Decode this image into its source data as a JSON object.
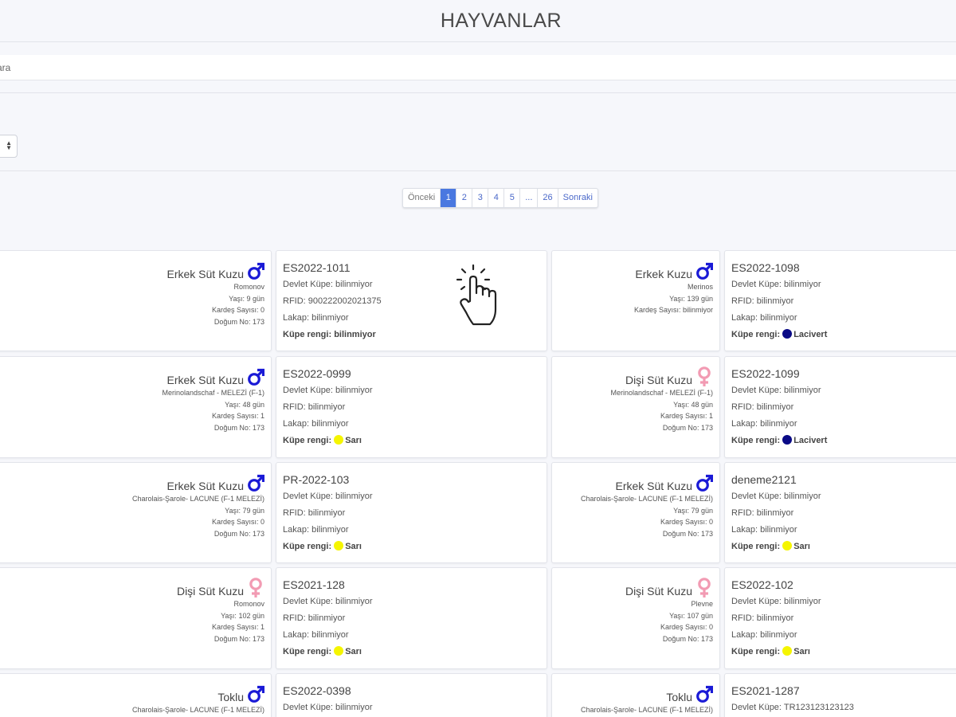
{
  "header": {
    "title": "HAYVANLAR"
  },
  "search": {
    "placeholder": "ara",
    "visible_prefix": "o ara"
  },
  "pagination": {
    "previous": "Önceki",
    "pages": [
      "1",
      "2",
      "3",
      "4",
      "5",
      "...",
      "26"
    ],
    "active": "1",
    "next": "Sonraki"
  },
  "colors": {
    "male": "#1a1ad6",
    "female": "#f29bb3",
    "active_page": "#4a78e0",
    "sari": "#f5f500",
    "lacivert": "#0a0a86"
  },
  "labels": {
    "devlet": "Devlet Küpe:",
    "rfid": "RFID:",
    "lakap": "Lakap:",
    "kupe_rengi": "Küpe rengi:",
    "yas": "Yaşı:",
    "kardes": "Kardeş Sayısı:",
    "dogum": "Doğum No:"
  },
  "cards": [
    {
      "type": "Erkek Süt Kuzu",
      "gender": "male",
      "breed": "Romonov",
      "age": "9 gün",
      "siblings": "0",
      "birth_no": "173",
      "tag": "ES2022-1011",
      "devlet": "bilinmiyor",
      "rfid": "900222002021375",
      "lakap": "bilinmiyor",
      "color": "bilinmiyor",
      "color_hex": ""
    },
    {
      "type": "Erkek Kuzu",
      "gender": "male",
      "breed": "Merinos",
      "age": "139 gün",
      "siblings": "bilinmiyor",
      "birth_no": "",
      "tag": "ES2022-1098",
      "devlet": "bilinmiyor",
      "rfid": "bilinmiyor",
      "lakap": "bilinmiyor",
      "color": "Lacivert",
      "color_hex": "#0a0a86"
    },
    {
      "type": "Erkek Süt Kuzu",
      "gender": "male",
      "breed": "Merinolandschaf - MELEZİ (F-1)",
      "age": "48 gün",
      "siblings": "1",
      "birth_no": "173",
      "tag": "ES2022-0999",
      "devlet": "bilinmiyor",
      "rfid": "bilinmiyor",
      "lakap": "bilinmiyor",
      "color": "Sarı",
      "color_hex": "#f5f500"
    },
    {
      "type": "Dişi Süt Kuzu",
      "gender": "female",
      "breed": "Merinolandschaf - MELEZİ (F-1)",
      "age": "48 gün",
      "siblings": "1",
      "birth_no": "173",
      "tag": "ES2022-1099",
      "devlet": "bilinmiyor",
      "rfid": "bilinmiyor",
      "lakap": "bilinmiyor",
      "color": "Lacivert",
      "color_hex": "#0a0a86"
    },
    {
      "type": "Erkek Süt Kuzu",
      "gender": "male",
      "breed": "Charolais-Şarole- LACUNE (F-1 MELEZİ)",
      "age": "79 gün",
      "siblings": "0",
      "birth_no": "173",
      "tag": "PR-2022-103",
      "devlet": "bilinmiyor",
      "rfid": "bilinmiyor",
      "lakap": "bilinmiyor",
      "color": "Sarı",
      "color_hex": "#f5f500"
    },
    {
      "type": "Erkek Süt Kuzu",
      "gender": "male",
      "breed": "Charolais-Şarole- LACUNE (F-1 MELEZİ)",
      "age": "79 gün",
      "siblings": "0",
      "birth_no": "173",
      "tag": "deneme2121",
      "devlet": "bilinmiyor",
      "rfid": "bilinmiyor",
      "lakap": "bilinmiyor",
      "color": "Sarı",
      "color_hex": "#f5f500"
    },
    {
      "type": "Dişi Süt Kuzu",
      "gender": "female",
      "breed": "Romonov",
      "age": "102 gün",
      "siblings": "1",
      "birth_no": "173",
      "tag": "ES2021-128",
      "devlet": "bilinmiyor",
      "rfid": "bilinmiyor",
      "lakap": "bilinmiyor",
      "color": "Sarı",
      "color_hex": "#f5f500"
    },
    {
      "type": "Dişi Süt Kuzu",
      "gender": "female",
      "breed": "Plevne",
      "age": "107 gün",
      "siblings": "0",
      "birth_no": "173",
      "tag": "ES2022-102",
      "devlet": "bilinmiyor",
      "rfid": "bilinmiyor",
      "lakap": "bilinmiyor",
      "color": "Sarı",
      "color_hex": "#f5f500"
    },
    {
      "type": "Toklu",
      "gender": "male",
      "breed": "Charolais-Şarole- LACUNE (F-1 MELEZİ)",
      "age": "",
      "siblings": "",
      "birth_no": "",
      "tag": "ES2022-0398",
      "devlet": "bilinmiyor",
      "rfid": "",
      "lakap": "",
      "color": "",
      "color_hex": ""
    },
    {
      "type": "Toklu",
      "gender": "male",
      "breed": "Charolais-Şarole- LACUNE (F-1 MELEZİ)",
      "age": "",
      "siblings": "",
      "birth_no": "",
      "tag": "ES2021-1287",
      "devlet": "TR123123123123",
      "rfid": "",
      "lakap": "",
      "color": "",
      "color_hex": ""
    }
  ]
}
